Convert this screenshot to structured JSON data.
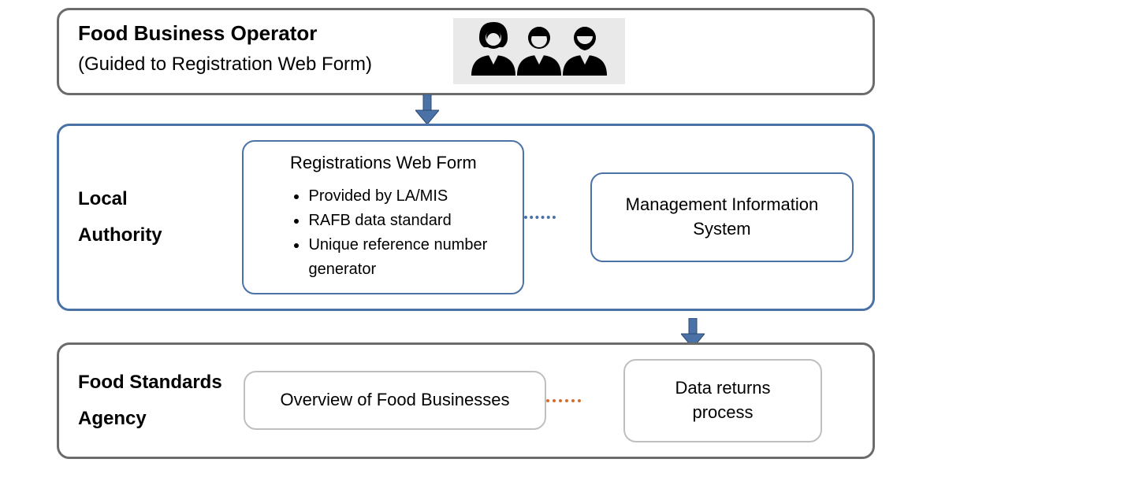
{
  "section1": {
    "title": "Food Business Operator",
    "subtitle": "(Guided to Registration Web Form)"
  },
  "section2": {
    "label_line1": "Local",
    "label_line2": "Authority",
    "reg_box_title": "Registrations Web Form",
    "reg_item1": "Provided by LA/MIS",
    "reg_item2": "RAFB data standard",
    "reg_item3": "Unique reference number generator",
    "mis_line1": "Management Information",
    "mis_line2": "System"
  },
  "section3": {
    "label_line1": "Food Standards",
    "label_line2": "Agency",
    "overview": "Overview of Food Businesses",
    "data_returns_line1": "Data returns",
    "data_returns_line2": "process"
  }
}
